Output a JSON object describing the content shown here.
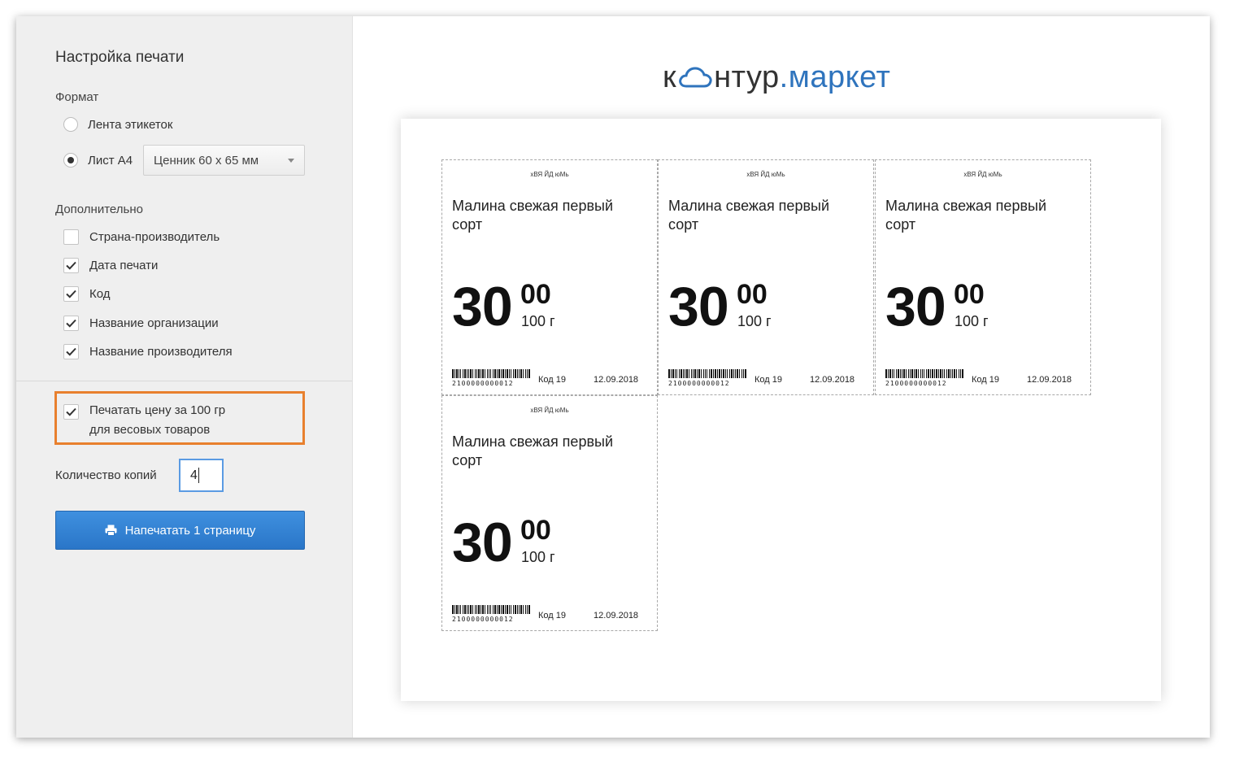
{
  "settings": {
    "title": "Настройка печати",
    "format_label": "Формат",
    "format_options": [
      {
        "label": "Лента этикеток",
        "selected": false
      },
      {
        "label": "Лист А4",
        "selected": true
      }
    ],
    "template_select": "Ценник 60 х 65 мм",
    "additional_label": "Дополнительно",
    "additional_options": [
      {
        "label": "Страна-производитель",
        "checked": false
      },
      {
        "label": "Дата печати",
        "checked": true
      },
      {
        "label": "Код",
        "checked": true
      },
      {
        "label": "Название организации",
        "checked": true
      },
      {
        "label": "Название производителя",
        "checked": true
      }
    ],
    "weight_price": {
      "line1": "Печатать цену за 100 гр",
      "line2": "для весовых товаров",
      "checked": true
    },
    "copies_label": "Количество копий",
    "copies_value": "4",
    "print_button": "Напечатать 1 страницу"
  },
  "logo": {
    "part1": "к",
    "part2": "нтур",
    "part3": ".маркет",
    "icon": "cloud-icon"
  },
  "price_tags": [
    {
      "org": "хВЯ ЙД юМь",
      "name": "Малина свежая первый сорт",
      "price_rub": "30",
      "price_kop": "00",
      "unit": "100 г",
      "barcode": "2100000000012",
      "code": "Код 19",
      "date": "12.09.2018"
    },
    {
      "org": "хВЯ ЙД юМь",
      "name": "Малина свежая первый сорт",
      "price_rub": "30",
      "price_kop": "00",
      "unit": "100 г",
      "barcode": "2100000000012",
      "code": "Код 19",
      "date": "12.09.2018"
    },
    {
      "org": "хВЯ ЙД юМь",
      "name": "Малина свежая первый сорт",
      "price_rub": "30",
      "price_kop": "00",
      "unit": "100 г",
      "barcode": "2100000000012",
      "code": "Код 19",
      "date": "12.09.2018"
    },
    {
      "org": "хВЯ ЙД юМь",
      "name": "Малина свежая первый сорт",
      "price_rub": "30",
      "price_kop": "00",
      "unit": "100 г",
      "barcode": "2100000000012",
      "code": "Код 19",
      "date": "12.09.2018"
    }
  ],
  "colors": {
    "accent_blue": "#2f74bd",
    "button_blue": "#2a76c8",
    "highlight_orange": "#e8802e",
    "sidebar_bg": "#efefef"
  }
}
